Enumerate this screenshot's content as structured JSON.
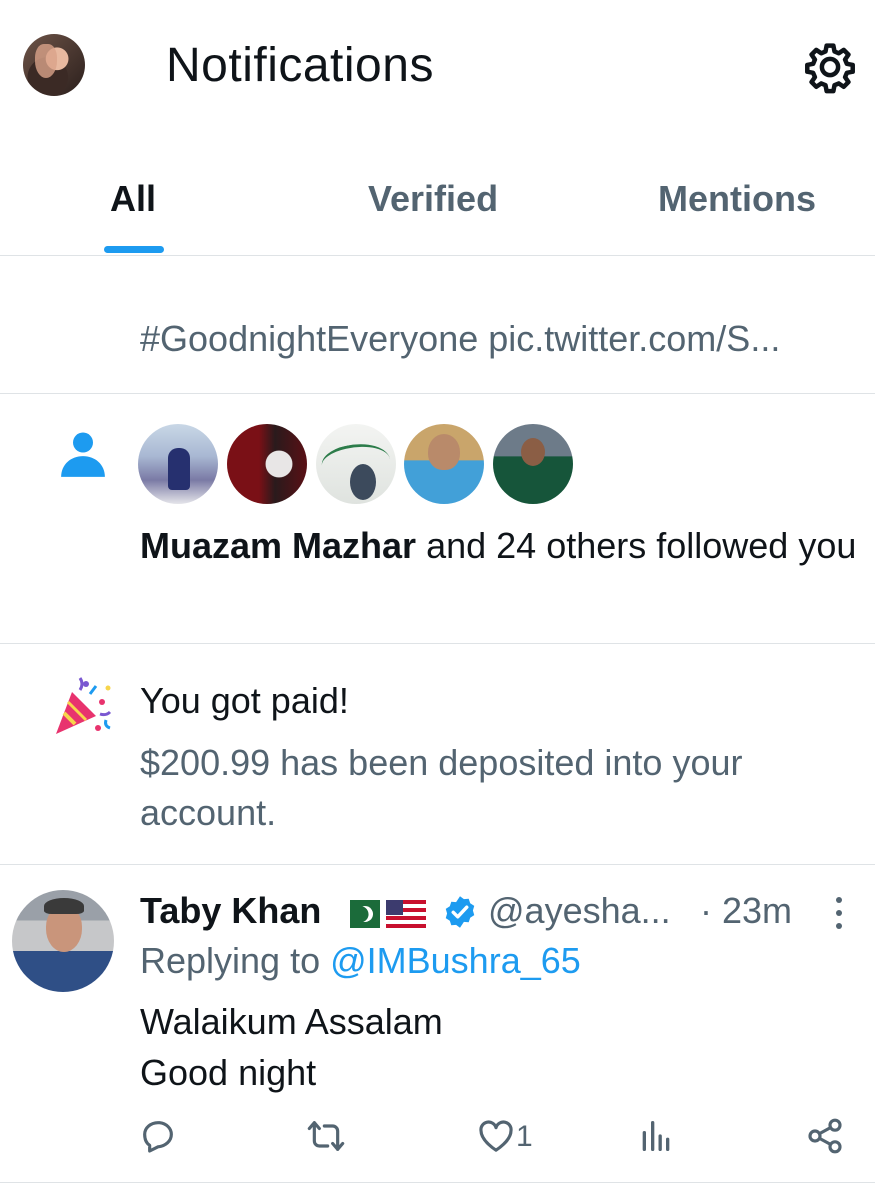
{
  "header": {
    "title": "Notifications"
  },
  "tabs": [
    {
      "label": "All",
      "active": true
    },
    {
      "label": "Verified",
      "active": false
    },
    {
      "label": "Mentions",
      "active": false
    }
  ],
  "previous_notification": {
    "hashtag_line": "#GoodnightEveryone pic.twitter.com/S..."
  },
  "follow_notification": {
    "name": "Muazam Mazhar",
    "rest": " and 24 others followed you"
  },
  "payment_notification": {
    "title": "You got paid!",
    "description": "$200.99 has been deposited into your account."
  },
  "tweet": {
    "author": "Taby Khan",
    "flags": [
      "🇵🇰",
      "🇺🇸"
    ],
    "handle": "@ayesha...",
    "time": "· 23m",
    "replying_prefix": "Replying to ",
    "replying_to": "@IMBushra_65",
    "text_line1": "Walaikum Assalam",
    "text_line2": "Good night",
    "like_count": "1"
  },
  "colors": {
    "accent": "#1d9bf0",
    "secondary_text": "#536471",
    "primary_text": "#0f1419"
  },
  "icons": [
    "gear-icon",
    "person-icon",
    "party-popper-icon",
    "verified-badge-icon",
    "more-icon",
    "reply-icon",
    "retweet-icon",
    "like-icon",
    "views-icon",
    "share-icon"
  ]
}
